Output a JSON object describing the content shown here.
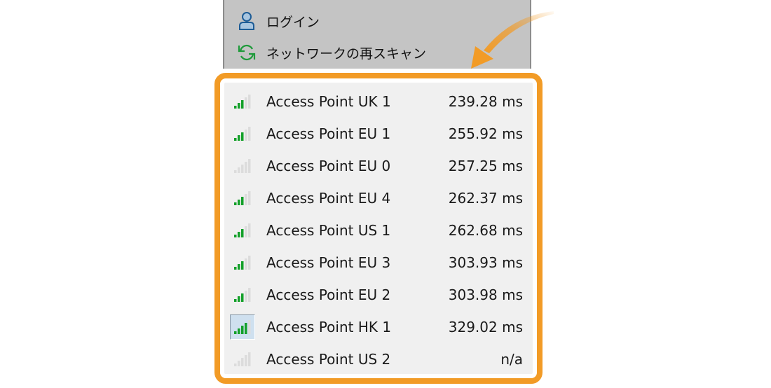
{
  "menu": {
    "items": [
      {
        "label": "ログイン",
        "icon": "user-icon"
      },
      {
        "label": "ネットワークの再スキャン",
        "icon": "refresh-icon"
      }
    ]
  },
  "access_points": [
    {
      "name": "Access Point UK 1",
      "ping": "239.28 ms",
      "signal_bars": 3,
      "selected": false
    },
    {
      "name": "Access Point EU 1",
      "ping": "255.92 ms",
      "signal_bars": 3,
      "selected": false
    },
    {
      "name": "Access Point EU 0",
      "ping": "257.25 ms",
      "signal_bars": 0,
      "selected": false
    },
    {
      "name": "Access Point EU 4",
      "ping": "262.37 ms",
      "signal_bars": 3,
      "selected": false
    },
    {
      "name": "Access Point US 1",
      "ping": "262.68 ms",
      "signal_bars": 3,
      "selected": false
    },
    {
      "name": "Access Point EU 3",
      "ping": "303.93 ms",
      "signal_bars": 3,
      "selected": false
    },
    {
      "name": "Access Point EU 2",
      "ping": "303.98 ms",
      "signal_bars": 3,
      "selected": false
    },
    {
      "name": "Access Point HK 1",
      "ping": "329.02 ms",
      "signal_bars": 4,
      "selected": true
    },
    {
      "name": "Access Point US 2",
      "ping": "n/a",
      "signal_bars": 0,
      "selected": false
    }
  ],
  "signal_max_bars": 5,
  "colors": {
    "highlight": "#f29b26",
    "signal_on": "#14a02a",
    "signal_off": "#dcdcdc",
    "menu_bg": "#c4c4c4"
  }
}
